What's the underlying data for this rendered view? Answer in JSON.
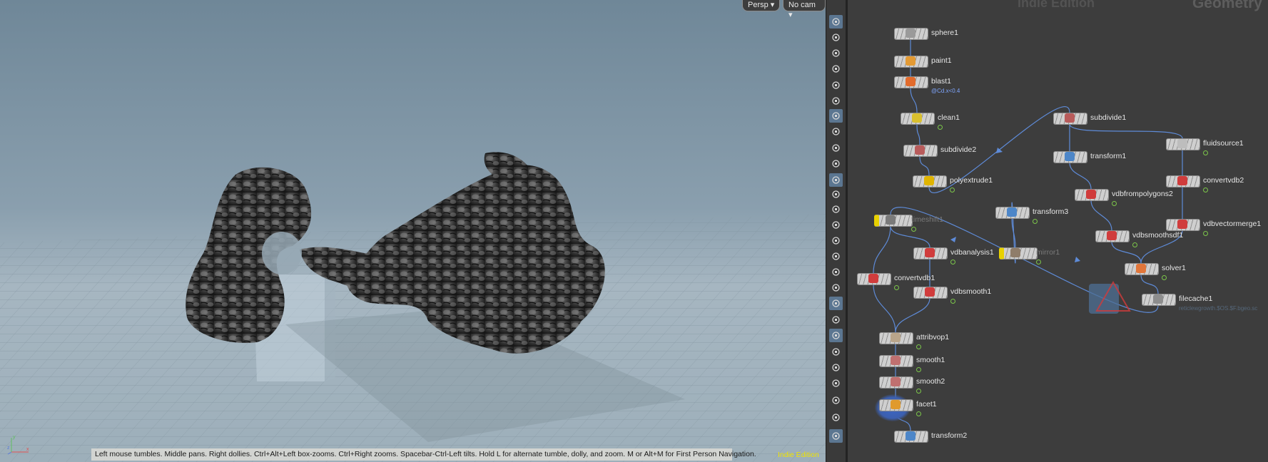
{
  "viewport": {
    "camera_menu": "Persp",
    "cam_menu": "No cam",
    "hud_text": "Left mouse tumbles. Middle pans. Right dollies. Ctrl+Alt+Left box-zooms. Ctrl+Right zooms. Spacebar-Ctrl-Left tilts. Hold L for alternate tumble, dolly, and zoom.    M or Alt+M for First Person Navigation.",
    "edition": "Indie Edition",
    "axes": [
      "x",
      "y",
      "z"
    ]
  },
  "toolbar": {
    "items": [
      "view-icon",
      "pose-icon",
      "lock-icon",
      "ghost-icon",
      "visibility-icon",
      "display-icon",
      "light-icon",
      "light-link-icon",
      "snapshot-icon",
      "render-icon",
      "camera-icon",
      "dot-icon",
      "brush-icon",
      "pen-icon",
      "number-icon",
      "paint-icon",
      "measure-icon",
      "angle-icon",
      "select-icon",
      "group-icon",
      "shader-icon",
      "texture-icon",
      "transform-icon",
      "box-icon",
      "image-icon",
      "pin-icon",
      "eye-icon"
    ]
  },
  "network": {
    "watermark": "Indie Edition",
    "context": "Geometry",
    "colors": {
      "wire": "#5e8bd8",
      "selected_glow": "#3d67c7",
      "bypass": "#e8d100",
      "flag": "#7cc64a"
    },
    "nodes": [
      {
        "id": "sphere1",
        "label": "sphere1",
        "icon": "sphere-icon"
      },
      {
        "id": "paint1",
        "label": "paint1",
        "icon": "paint-icon"
      },
      {
        "id": "blast1",
        "label": "blast1",
        "icon": "blast-icon",
        "sub": "@Cd.x<0.4"
      },
      {
        "id": "clean1",
        "label": "clean1",
        "icon": "clean-icon"
      },
      {
        "id": "subdivide2",
        "label": "subdivide2",
        "icon": "subdivide-icon"
      },
      {
        "id": "polyextrude1",
        "label": "polyextrude1",
        "icon": "polyextrude-icon"
      },
      {
        "id": "timeshift1",
        "label": "timeshift1",
        "icon": "timeshift-icon",
        "bypass": true
      },
      {
        "id": "vdbanalysis1",
        "label": "vdbanalysis1",
        "icon": "vdb-icon"
      },
      {
        "id": "convertvdb1",
        "label": "convertvdb1",
        "icon": "vdb-icon"
      },
      {
        "id": "vdbsmooth1",
        "label": "vdbsmooth1",
        "icon": "vdb-icon"
      },
      {
        "id": "attribvop1",
        "label": "attribvop1",
        "icon": "vop-icon"
      },
      {
        "id": "smooth1",
        "label": "smooth1",
        "icon": "smooth-icon"
      },
      {
        "id": "smooth2",
        "label": "smooth2",
        "icon": "smooth-icon"
      },
      {
        "id": "facet1",
        "label": "facet1",
        "icon": "facet-icon"
      },
      {
        "id": "transform2",
        "label": "transform2",
        "icon": "transform-icon"
      },
      {
        "id": "subdivide1",
        "label": "subdivide1",
        "icon": "subdivide-icon"
      },
      {
        "id": "transform1",
        "label": "transform1",
        "icon": "transform-icon"
      },
      {
        "id": "vdbfrompolygons2",
        "label": "vdbfrompolygons2",
        "icon": "vdb-icon"
      },
      {
        "id": "vdbsmoothsdf1",
        "label": "vdbsmoothsdf1",
        "icon": "vdb-icon"
      },
      {
        "id": "transform3",
        "label": "transform3",
        "icon": "transform-icon"
      },
      {
        "id": "mirror1",
        "label": "mirror1",
        "icon": "mirror-icon",
        "bypass": true
      },
      {
        "id": "fluidsource1",
        "label": "fluidsource1",
        "icon": "fluidsource-icon"
      },
      {
        "id": "convertvdb2",
        "label": "convertvdb2",
        "icon": "vdb-icon"
      },
      {
        "id": "vdbvectormerge1",
        "label": "vdbvectormerge1",
        "icon": "vdb-icon"
      },
      {
        "id": "solver1",
        "label": "solver1",
        "icon": "solver-icon"
      },
      {
        "id": "filecache1",
        "label": "filecache1",
        "icon": "filecache-icon",
        "sub": "reticlewgrowth.$OS.$F.bgeo.sc"
      }
    ]
  }
}
